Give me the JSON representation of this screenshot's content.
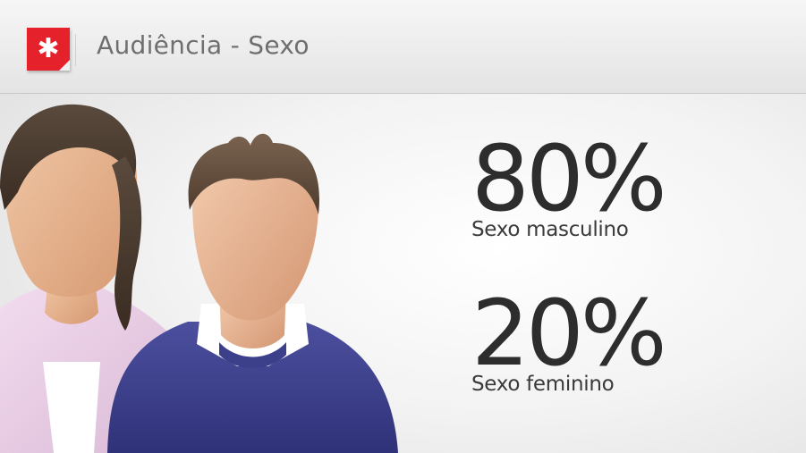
{
  "header": {
    "logo_icon": "asterisk-icon",
    "logo_color": "#e5212b",
    "title": "Audiência - Sexo"
  },
  "illustration": {
    "figures": [
      "woman-avatar-icon",
      "man-avatar-icon"
    ]
  },
  "stats": {
    "male": {
      "value": "80%",
      "label": "Sexo masculino"
    },
    "female": {
      "value": "20%",
      "label": "Sexo feminino"
    }
  }
}
